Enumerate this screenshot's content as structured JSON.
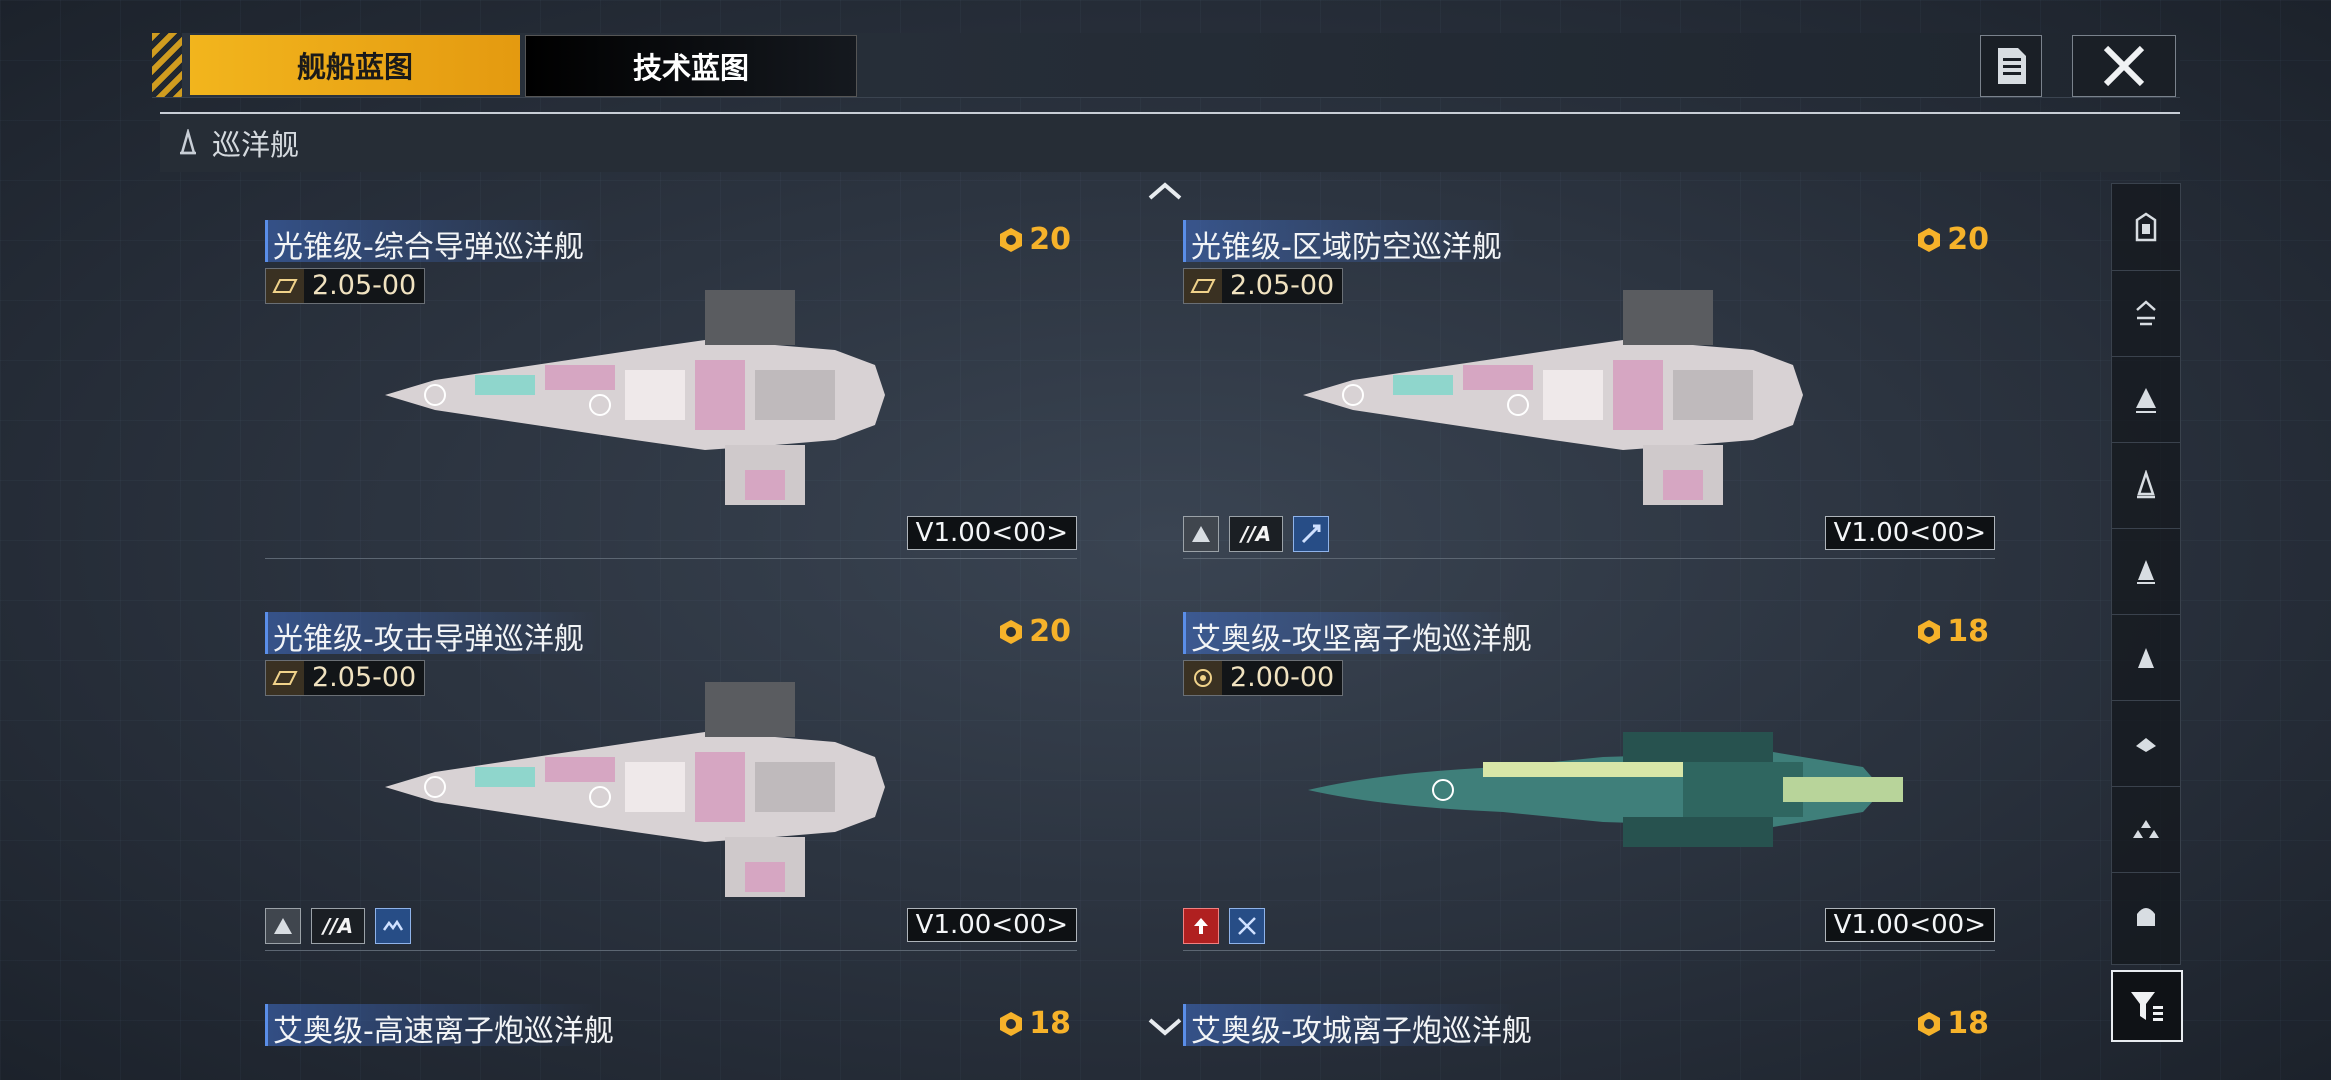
{
  "tabs": {
    "ship_blueprint": "舰船蓝图",
    "tech_blueprint": "技术蓝图"
  },
  "category": {
    "label": "巡洋舰",
    "icon": "cruiser-icon"
  },
  "colors": {
    "accent": "#f2b51d",
    "cost": "#f6b22a",
    "title_bar": "#406ec8"
  },
  "cards": [
    {
      "title": "光锥级-综合导弹巡洋舰",
      "cost": "20",
      "tech_version": "2.05-00",
      "build_version": "V1.00<00>",
      "badges": []
    },
    {
      "title": "光锥级-区域防空巡洋舰",
      "cost": "20",
      "tech_version": "2.05-00",
      "build_version": "V1.00<00>",
      "badges": [
        "armor-icon",
        "A",
        "aa-weapon-icon"
      ]
    },
    {
      "title": "光锥级-攻击导弹巡洋舰",
      "cost": "20",
      "tech_version": "2.05-00",
      "build_version": "V1.00<00>",
      "badges": [
        "armor-icon",
        "A",
        "wave-icon"
      ]
    },
    {
      "title": "艾奥级-攻坚离子炮巡洋舰",
      "cost": "18",
      "tech_version": "2.00-00",
      "build_version": "V1.00<00>",
      "badges": [
        "arrow-up-icon",
        "cross-swords-icon"
      ]
    },
    {
      "title": "艾奥级-高速离子炮巡洋舰",
      "cost": "18"
    },
    {
      "title": "艾奥级-攻城离子炮巡洋舰",
      "cost": "18"
    }
  ],
  "badge_text": "//A",
  "sidebar": [
    "carrier-icon",
    "battlecruiser-icon",
    "battleship-icon",
    "cruiser-icon",
    "destroyer-icon",
    "frigate-icon",
    "corvette-icon",
    "fighter-icon",
    "aux-ship-icon"
  ]
}
